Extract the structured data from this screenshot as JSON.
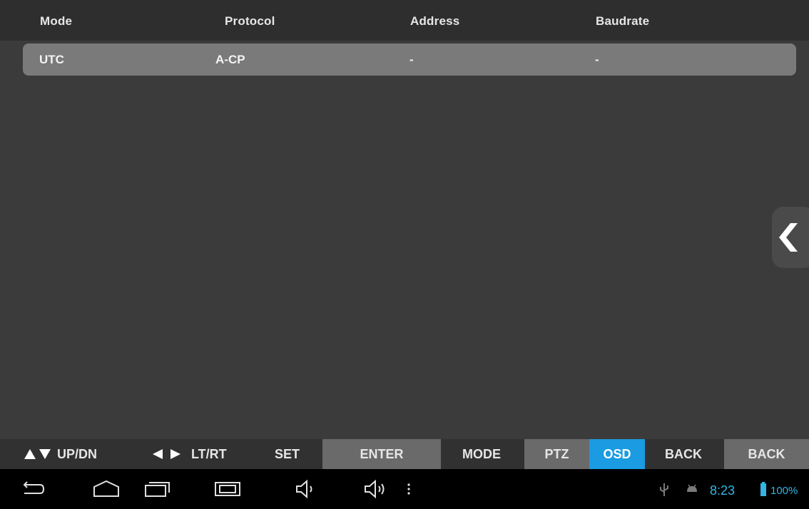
{
  "table": {
    "headers": [
      "Mode",
      "Protocol",
      "Address",
      "Baudrate"
    ],
    "rows": [
      {
        "mode": "UTC",
        "protocol": "A-CP",
        "address": "-",
        "baudrate": "-"
      }
    ]
  },
  "controls": {
    "updn_label": "UP/DN",
    "ltrt_label": "LT/RT",
    "set_label": "SET",
    "enter_label": "ENTER",
    "mode_label": "MODE",
    "ptz_label": "PTZ",
    "osd_label": "OSD",
    "back_label": "BACK",
    "back_button_label": "BACK",
    "active_mode": "OSD"
  },
  "status": {
    "time": "8:23",
    "battery": "100%"
  },
  "colors": {
    "accent": "#1a9be2",
    "status": "#33b5e5"
  },
  "icons": [
    "up-arrow-icon",
    "down-arrow-icon",
    "left-arrow-icon",
    "right-arrow-icon",
    "chevron-left-icon",
    "back-icon",
    "home-icon",
    "recent-apps-icon",
    "screenshot-icon",
    "volume-down-icon",
    "volume-up-icon",
    "menu-icon",
    "usb-icon",
    "android-icon",
    "battery-icon"
  ]
}
